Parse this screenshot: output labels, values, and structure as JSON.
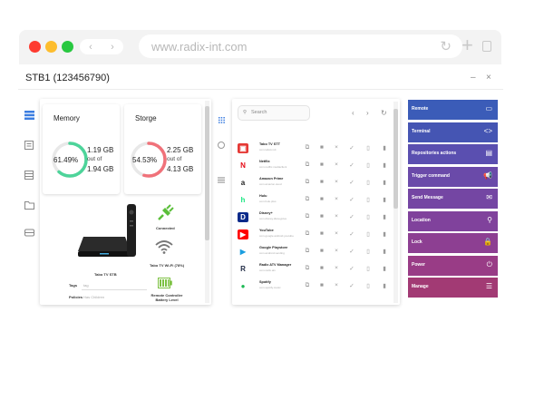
{
  "browser": {
    "url": "www.radix-int.com",
    "nav_back": "‹",
    "nav_forward": "›",
    "reload_icon": "↻",
    "new_tab_icon": "+"
  },
  "window": {
    "title": "STB1 (123456790)",
    "minimize": "–",
    "close": "×"
  },
  "memory": {
    "title": "Memory",
    "percent": "61.49%",
    "percent_value": 61.49,
    "used": "1.19 GB",
    "out_of": "out of",
    "total": "1.94 GB",
    "color": "#4dd49a"
  },
  "storage": {
    "title": "Storge",
    "percent": "54.53%",
    "percent_value": 54.53,
    "used": "2.25 GB",
    "out_of": "out of",
    "total": "4.13 GB",
    "color": "#f0727a"
  },
  "device": {
    "name": "Tabo TV STB",
    "tags_label": "Tags",
    "tags_value": "tag",
    "policies_label": "Policies",
    "policies_value": "Has Children",
    "connected": "Connected",
    "wifi": "Tabo TV Wi-Fi (78%)",
    "battery": "Remote Controller Battery Level"
  },
  "apps": {
    "search_placeholder": "Search",
    "prev": "‹",
    "next": "›",
    "refresh": "↻",
    "items": [
      {
        "name": "Tabo TV STT",
        "sub": "com.tabotv.stt",
        "logo": "▣",
        "bg": "#e53935",
        "fg": "#fff"
      },
      {
        "name": "Netflix",
        "sub": "com.netflix.mediaclient",
        "logo": "N",
        "bg": "#fff",
        "fg": "#e50914"
      },
      {
        "name": "Amazon Prime",
        "sub": "com.amazon.avod",
        "logo": "a",
        "bg": "#fff",
        "fg": "#222"
      },
      {
        "name": "Hulu",
        "sub": "com.hulu.plus",
        "logo": "h",
        "bg": "#fff",
        "fg": "#1ce783"
      },
      {
        "name": "Disney+",
        "sub": "com.disney.disneyplus",
        "logo": "D",
        "bg": "#0b2a8a",
        "fg": "#fff"
      },
      {
        "name": "YouTube",
        "sub": "com.google.android.youtube",
        "logo": "▶",
        "bg": "#ff0000",
        "fg": "#fff"
      },
      {
        "name": "Google Playstore",
        "sub": "com.android.vending",
        "logo": "▶",
        "bg": "#fff",
        "fg": "#1a9ee0"
      },
      {
        "name": "Radix ATV Manager",
        "sub": "com.radix.atv",
        "logo": "R",
        "bg": "#fff",
        "fg": "#1f2a44"
      },
      {
        "name": "Spotify",
        "sub": "com.spotify.music",
        "logo": "●",
        "bg": "#fff",
        "fg": "#1db954"
      }
    ],
    "row_actions": [
      "⧉",
      "■",
      "×",
      "✓",
      "▯",
      "▮"
    ]
  },
  "actions": [
    {
      "label": "Remote",
      "icon": "▭",
      "color": "#3b5cb8"
    },
    {
      "label": "Terminal",
      "icon": "<>",
      "color": "#4555b3"
    },
    {
      "label": "Repositories actions",
      "icon": "▤",
      "color": "#5a4fb0"
    },
    {
      "label": "Trigger command",
      "icon": "📢",
      "color": "#6a4aa9"
    },
    {
      "label": "Send Message",
      "icon": "✉",
      "color": "#7446a3"
    },
    {
      "label": "Location",
      "icon": "⚲",
      "color": "#80429c"
    },
    {
      "label": "Lock",
      "icon": "🔒",
      "color": "#8d3f92"
    },
    {
      "label": "Power",
      "icon": "⏻",
      "color": "#993c86"
    },
    {
      "label": "Manage",
      "icon": "☰",
      "color": "#a23a74"
    }
  ]
}
